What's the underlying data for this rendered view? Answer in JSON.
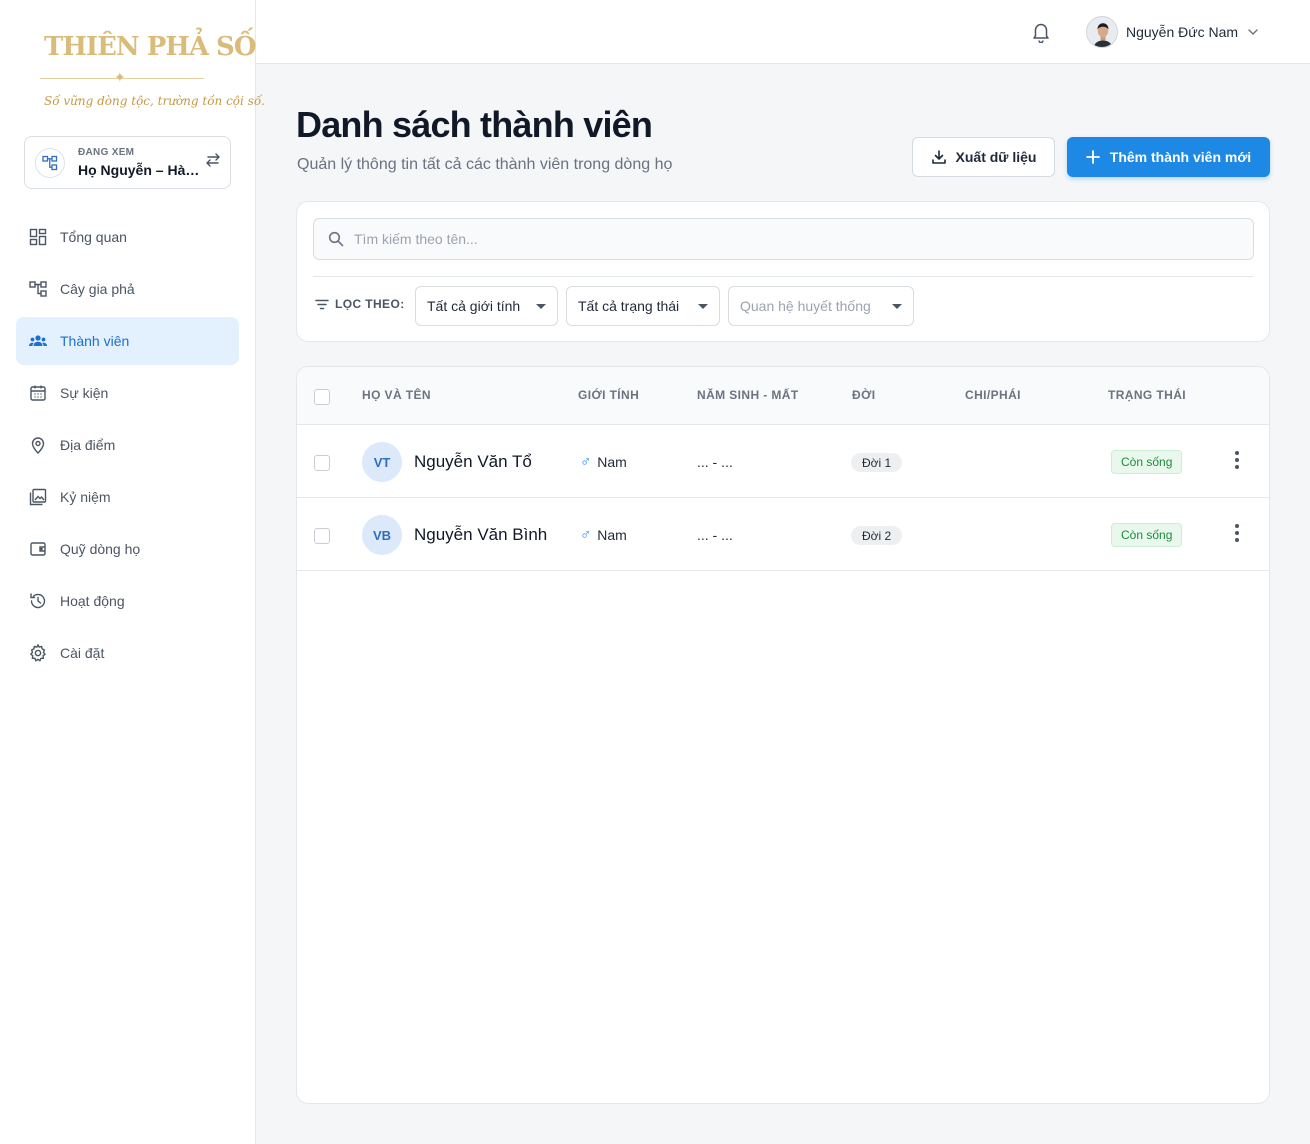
{
  "brand": {
    "logo_text": "THIÊN PHẢ SỐ",
    "slogan": "Số vững dòng tộc, trường tồn cội số."
  },
  "viewing": {
    "label": "ĐANG XEM",
    "family_name": "Họ Nguyễn – Hà Nội"
  },
  "nav": {
    "items": [
      {
        "label": "Tổng quan",
        "icon": "dashboard-icon"
      },
      {
        "label": "Cây gia phả",
        "icon": "tree-icon"
      },
      {
        "label": "Thành viên",
        "icon": "people-icon",
        "active": true
      },
      {
        "label": "Sự kiện",
        "icon": "calendar-icon"
      },
      {
        "label": "Địa điểm",
        "icon": "location-icon"
      },
      {
        "label": "Kỷ niệm",
        "icon": "photo-icon"
      },
      {
        "label": "Quỹ dòng họ",
        "icon": "wallet-icon"
      },
      {
        "label": "Hoạt động",
        "icon": "history-icon"
      },
      {
        "label": "Cài đặt",
        "icon": "gear-icon"
      }
    ]
  },
  "topbar": {
    "user_name": "Nguyễn Đức Nam"
  },
  "page": {
    "title": "Danh sách thành viên",
    "subtitle": "Quản lý thông tin tất cả các thành viên trong dòng họ",
    "export_label": "Xuất dữ liệu",
    "add_label": "Thêm thành viên mới"
  },
  "filters": {
    "search_placeholder": "Tìm kiếm theo tên...",
    "label": "LỌC THEO:",
    "gender": "Tất cả giới tính",
    "status": "Tất cả trạng thái",
    "relation_placeholder": "Quan hệ huyết thống"
  },
  "table": {
    "columns": [
      "HỌ VÀ TÊN",
      "GIỚI TÍNH",
      "NĂM SINH - MẤT",
      "ĐỜI",
      "CHI/PHÁI",
      "TRẠNG THÁI"
    ],
    "rows": [
      {
        "initials": "VT",
        "name": "Nguyễn Văn Tổ",
        "gender_symbol": "♂",
        "gender": "Nam",
        "years": "... - ...",
        "generation": "Đời 1",
        "branch": "",
        "status": "Còn sống"
      },
      {
        "initials": "VB",
        "name": "Nguyễn Văn Bình",
        "gender_symbol": "♂",
        "gender": "Nam",
        "years": "... - ...",
        "generation": "Đời 2",
        "branch": "",
        "status": "Còn sống"
      }
    ]
  },
  "colors": {
    "primary": "#1e88e5",
    "active_nav_bg": "#e3f0fd",
    "status_alive": "#1f8a3b",
    "brand_gold": "#d9bc7a"
  }
}
